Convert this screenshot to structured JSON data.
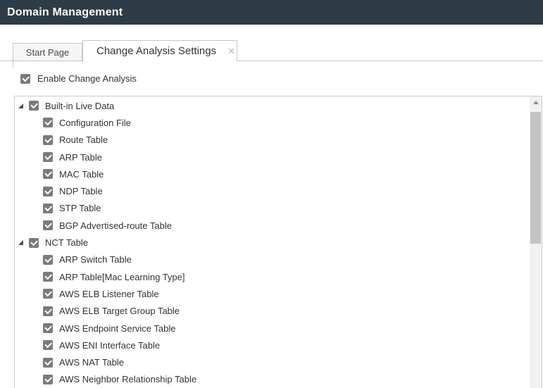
{
  "header": {
    "title": "Domain Management"
  },
  "tabs": [
    {
      "label": "Start Page",
      "active": false
    },
    {
      "label": "Change Analysis Settings",
      "active": true,
      "closable": true
    }
  ],
  "icons": {
    "tab_close": "✕"
  },
  "settings": {
    "enable_label": "Enable Change Analysis",
    "enable_checked": true
  },
  "tree": [
    {
      "label": "Built-in Live Data",
      "expanded": true,
      "checked": true,
      "children": [
        {
          "label": "Configuration File",
          "checked": true
        },
        {
          "label": "Route Table",
          "checked": true
        },
        {
          "label": "ARP Table",
          "checked": true
        },
        {
          "label": "MAC Table",
          "checked": true
        },
        {
          "label": "NDP Table",
          "checked": true
        },
        {
          "label": "STP Table",
          "checked": true
        },
        {
          "label": "BGP Advertised-route Table",
          "checked": true
        }
      ]
    },
    {
      "label": "NCT Table",
      "expanded": true,
      "checked": true,
      "children": [
        {
          "label": "ARP Switch Table",
          "checked": true
        },
        {
          "label": "ARP Table[Mac Learning Type]",
          "checked": true
        },
        {
          "label": "AWS ELB Listener Table",
          "checked": true
        },
        {
          "label": "AWS ELB Target Group Table",
          "checked": true
        },
        {
          "label": "AWS Endpoint Service Table",
          "checked": true
        },
        {
          "label": "AWS ENI Interface Table",
          "checked": true
        },
        {
          "label": "AWS NAT Table",
          "checked": true
        },
        {
          "label": "AWS Neighbor Relationship Table",
          "checked": true
        }
      ]
    }
  ],
  "colors": {
    "header_bg": "#2d3c46",
    "border": "#c5c5c5",
    "checkbox": "#7b7b7b",
    "scroll_track": "#f1f1f1",
    "scroll_thumb": "#c3c3c3"
  }
}
